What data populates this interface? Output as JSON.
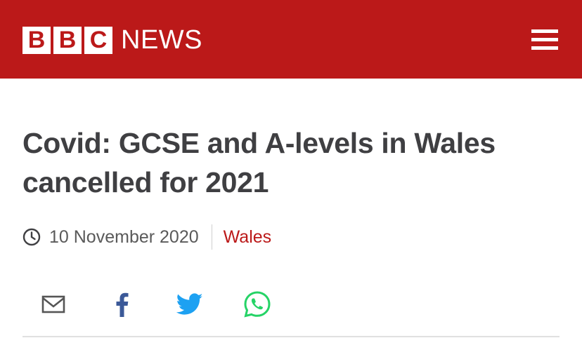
{
  "brand": {
    "bbc_letters": [
      "B",
      "B",
      "C"
    ],
    "news_label": "NEWS",
    "header_color": "#bb1919"
  },
  "nav": {
    "menu_icon": "hamburger-menu-icon"
  },
  "article": {
    "headline": "Covid: GCSE and A-levels in Wales cancelled for 2021",
    "date": "10 November 2020",
    "section": "Wales",
    "clock_icon": "clock-icon"
  },
  "share": {
    "icons": [
      "email-icon",
      "facebook-icon",
      "twitter-icon",
      "whatsapp-icon"
    ],
    "colors": {
      "email": "#555555",
      "facebook": "#3b5998",
      "twitter": "#1da1f2",
      "whatsapp": "#25d366"
    }
  }
}
